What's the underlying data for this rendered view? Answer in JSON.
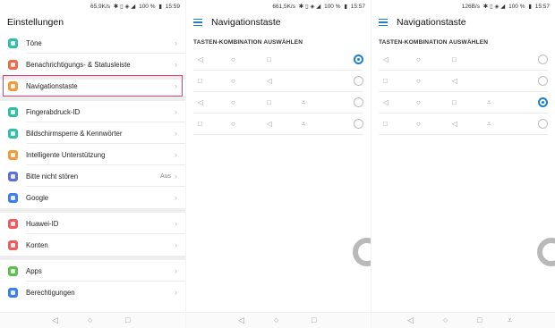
{
  "settings_panel": {
    "status": {
      "speed": "65,9K/s",
      "icons": "✱ ▯ ◈ ◢",
      "battery": "100 %",
      "time": "15:59"
    },
    "title": "Einstellungen",
    "items": [
      {
        "label": "Töne",
        "icon": "speaker-icon",
        "color": "#2fbfa4"
      },
      {
        "label": "Benachrichtigungs- & Statusleiste",
        "icon": "bell-icon",
        "color": "#f06a4a"
      },
      {
        "label": "Navigationstaste",
        "icon": "navigation-key-icon",
        "color": "#f29a3b"
      },
      {
        "label": "Fingerabdruck-ID",
        "icon": "fingerprint-icon",
        "color": "#2fbfa4"
      },
      {
        "label": "Bildschirmsperre & Kennwörter",
        "icon": "lock-icon",
        "color": "#2fbfa4"
      },
      {
        "label": "Intelligente Unterstützung",
        "icon": "hand-icon",
        "color": "#f29a3b"
      },
      {
        "label": "Bitte nicht stören",
        "value": "Aus",
        "icon": "moon-icon",
        "color": "#5b6fd6"
      },
      {
        "label": "Google",
        "icon": "google-icon",
        "color": "#3c7df2"
      },
      {
        "label": "Huawei-ID",
        "icon": "huawei-icon",
        "color": "#f05a5a"
      },
      {
        "label": "Konten",
        "icon": "user-icon",
        "color": "#f05a5a"
      },
      {
        "label": "Apps",
        "icon": "apps-icon",
        "color": "#5ac04a"
      },
      {
        "label": "Berechtigungen",
        "icon": "key-icon",
        "color": "#3c7df2"
      }
    ]
  },
  "nav_panel_left": {
    "status": {
      "speed": "661,5K/s",
      "icons": "✱ ▯ ◈ ◢",
      "battery": "100 %",
      "time": "15:57"
    },
    "title": "Navigationstaste",
    "section_title": "TASTEN-KOMBINATION AUSWÄHLEN",
    "selected_option": 1
  },
  "nav_panel_right": {
    "status": {
      "speed": "126B/s",
      "icons": "✱ ▯ ◈ ◢",
      "battery": "100 %",
      "time": "15:57"
    },
    "title": "Navigationstaste",
    "section_title": "TASTEN-KOMBINATION AUSWÄHLEN",
    "selected_option": 3
  },
  "glyphs": {
    "back": "◁",
    "home": "○",
    "recent": "□",
    "notification": "⩡"
  },
  "colors": {
    "accent": "#1a7fd0",
    "highlight": "#e13d7a"
  }
}
